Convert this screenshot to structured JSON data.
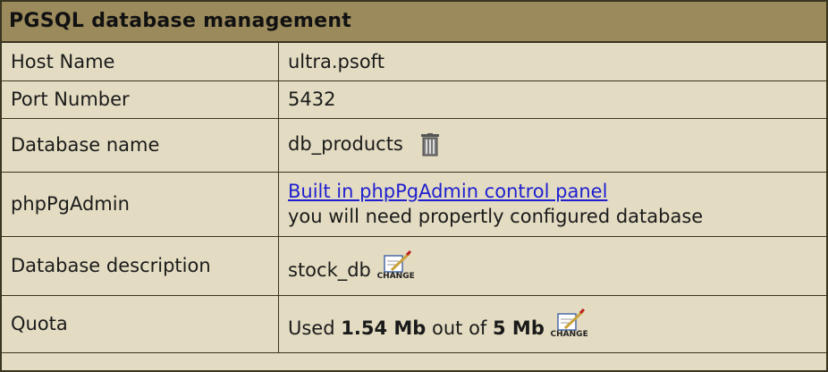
{
  "panel": {
    "title": "PGSQL database management"
  },
  "rows": {
    "host": {
      "label": "Host Name",
      "value": "ultra.psoft"
    },
    "port": {
      "label": "Port Number",
      "value": "5432"
    },
    "dbname": {
      "label": "Database name",
      "value": "db_products",
      "icon": "trash-icon"
    },
    "phppgadmin": {
      "label": "phpPgAdmin",
      "link_text": "Built in phpPgAdmin control panel",
      "note": "you will need propertly configured database"
    },
    "description": {
      "label": "Database description",
      "value": "stock_db",
      "change_label": "CHANGE"
    },
    "quota": {
      "label": "Quota",
      "prefix": "Used",
      "used": "1.54 Mb",
      "middle": "out of",
      "total": "5 Mb",
      "change_label": "CHANGE"
    }
  },
  "colors": {
    "header_bg": "#9a8a5c",
    "body_bg": "#e3dcc2",
    "border": "#3a3520",
    "link": "#1f1fd0"
  }
}
